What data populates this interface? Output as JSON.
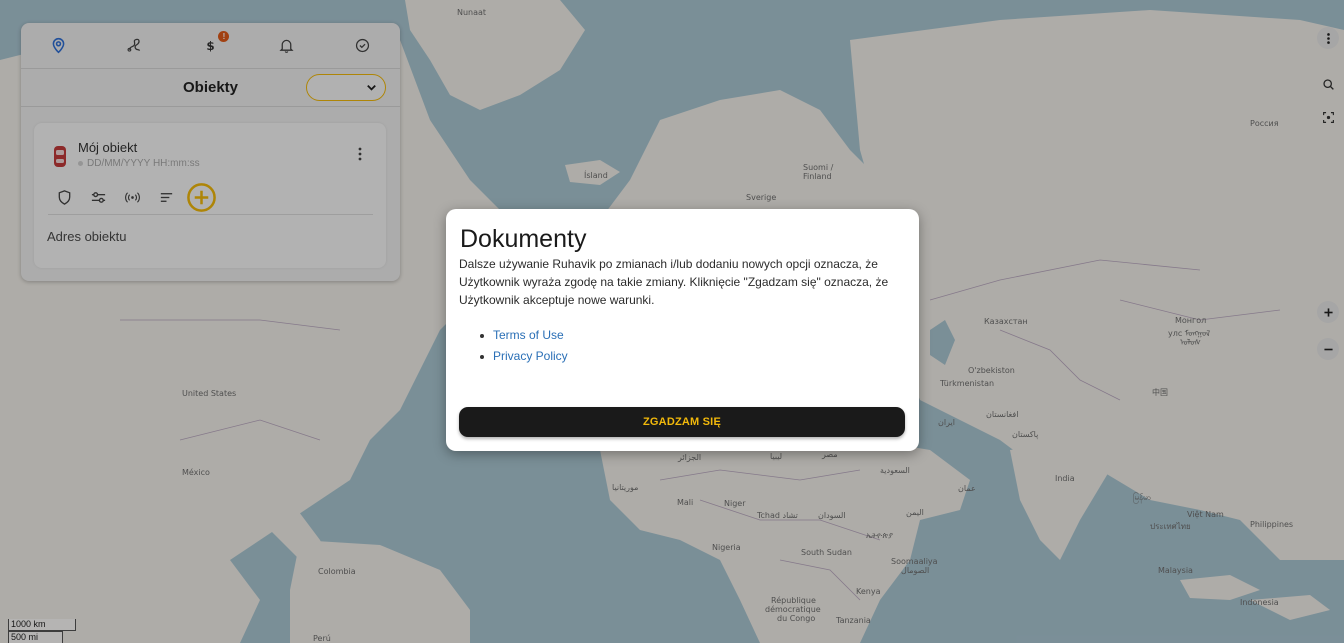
{
  "map": {
    "labels": {
      "nunaat": "Nunaat",
      "island": "Ísland",
      "suomi": "Suomi /",
      "finland": "Finland",
      "sverige": "Sverige",
      "rossiya": "Россия",
      "united_states": "United States",
      "mexico": "México",
      "colombia": "Colombia",
      "peru": "Perú",
      "kazakhstan": "Казахстан",
      "mongolia": "Монгол",
      "mongolia2": "улс ᠮᠣᠩᠭᠣᠯ",
      "mongolia3": "ᠤᠯᠤᠰ",
      "uzbekistan": "O'zbekiston",
      "turkmenistan": "Türkmenistan",
      "china": "中国",
      "afghanistan": "افغانستان",
      "pakistan": "پاکستان",
      "iran": "ایران",
      "india": "India",
      "algeria": "الجزائر",
      "libya": "ليبيا",
      "egypt": "مصر",
      "saudi": "السعودية",
      "oman": "عمان",
      "mauritania": "موريتانيا",
      "mali": "Mali",
      "niger": "Niger",
      "tchad": "Tchad تشاد",
      "sudan": "السودان",
      "yemen": "اليمن",
      "eritrea": "ኤትዮጵያ",
      "nigeria": "Nigeria",
      "south_sudan": "South Sudan",
      "somalia": "Soomaaliya",
      "somalia2": "الصومال",
      "kenya": "Kenya",
      "drc1": "République",
      "drc2": "démocratique",
      "drc3": "du Congo",
      "tanzania": "Tanzania",
      "myanmar": "မြန်မာ",
      "vietnam": "Việt Nam",
      "thailand": "ประเทศไทย",
      "philippines": "Philippines",
      "malaysia": "Malaysia",
      "indonesia": "Indonesia"
    },
    "colors": {
      "water": "#aac6d2",
      "land": "#f2efe9",
      "border": "#b9a8c0"
    }
  },
  "panel": {
    "tabs": [
      {
        "name": "location",
        "icon": "location-pin-icon",
        "active": true
      },
      {
        "name": "routes",
        "icon": "route-icon"
      },
      {
        "name": "billing",
        "icon": "dollar-icon",
        "badge": "!"
      },
      {
        "name": "notifications",
        "icon": "bell-icon"
      },
      {
        "name": "status",
        "icon": "check-circle-icon"
      }
    ],
    "title": "Obiekty",
    "select_value": "",
    "object": {
      "name": "Mój obiekt",
      "datetime": "DD/MM/YYYY HH:mm:ss",
      "address": "Adres obiektu",
      "icons": [
        "shield-icon",
        "sliders-icon",
        "signal-icon",
        "sort-icon",
        "add-circle-icon"
      ]
    },
    "accent": "#f2b90b"
  },
  "scale": {
    "km": "1000 km",
    "mi": "500 mi"
  },
  "modal": {
    "title": "Dokumenty",
    "body": "Dalsze używanie Ruhavik po zmianach i/lub dodaniu nowych opcji oznacza, że Użytkownik wyraża zgodę na takie zmiany. Kliknięcie \"Zgadzam się\" oznacza, że Użytkownik akceptuje nowe warunki.",
    "links": [
      "Terms of Use",
      "Privacy Policy"
    ],
    "agree_label": "ZGADZAM SIĘ"
  }
}
